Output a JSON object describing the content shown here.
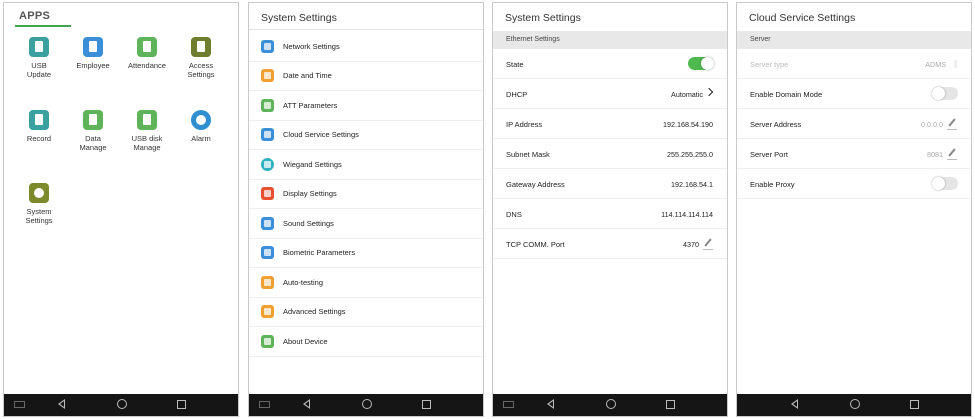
{
  "apps_panel": {
    "tab": "APPS",
    "items": [
      {
        "label": "USB\nUpdate",
        "color": "#3aa0a0"
      },
      {
        "label": "Employee",
        "color": "#3a8fd8"
      },
      {
        "label": "Attendance",
        "color": "#5fb35a"
      },
      {
        "label": "Access\nSettings",
        "color": "#6f7e2e"
      },
      {
        "label": "Record",
        "color": "#3aa0a0"
      },
      {
        "label": "Data\nManage",
        "color": "#5fb35a"
      },
      {
        "label": "USB disk\nManage",
        "color": "#5fb35a"
      },
      {
        "label": "Alarm",
        "color": "#2f8fd0"
      },
      {
        "label": "System\nSettings",
        "color": "#7d8a2c"
      }
    ]
  },
  "system_settings_panel": {
    "title": "System Settings",
    "items": [
      {
        "label": "Network Settings",
        "color": "#3b8fd8"
      },
      {
        "label": "Date and Time",
        "color": "#f0a030"
      },
      {
        "label": "ATT Parameters",
        "color": "#5fb35a"
      },
      {
        "label": "Cloud Service Settings",
        "color": "#3b8fd8"
      },
      {
        "label": "Wiegand Settings",
        "color": "#2fb0c0"
      },
      {
        "label": "Display Settings",
        "color": "#e85030"
      },
      {
        "label": "Sound Settings",
        "color": "#3b8fd8"
      },
      {
        "label": "Biometric Parameters",
        "color": "#3b8fd8"
      },
      {
        "label": "Auto-testing",
        "color": "#f0a030"
      },
      {
        "label": "Advanced Settings",
        "color": "#f0a030"
      },
      {
        "label": "About Device",
        "color": "#5fb35a"
      }
    ]
  },
  "ethernet_panel": {
    "title": "System Settings",
    "section": "Ethernet Settings",
    "rows": {
      "state": {
        "label": "State",
        "on": true
      },
      "dhcp": {
        "label": "DHCP",
        "value": "Automatic"
      },
      "ip": {
        "label": "IP Address",
        "value": "192.168.54.190"
      },
      "mask": {
        "label": "Subnet Mask",
        "value": "255.255.255.0"
      },
      "gateway": {
        "label": "Gateway Address",
        "value": "192.168.54.1"
      },
      "dns": {
        "label": "DNS",
        "value": "114.114.114.114"
      },
      "port": {
        "label": "TCP COMM. Port",
        "value": "4370"
      }
    }
  },
  "cloud_panel": {
    "title": "Cloud Service Settings",
    "section": "Server",
    "rows": {
      "server_type": {
        "label": "Server type",
        "value": "ADMS"
      },
      "domain_mode": {
        "label": "Enable Domain Mode",
        "on": false
      },
      "address": {
        "label": "Server Address",
        "value": "0.0.0.0"
      },
      "port": {
        "label": "Server Port",
        "value": "8081"
      },
      "proxy": {
        "label": "Enable Proxy",
        "on": false
      }
    }
  },
  "colors": {
    "accent": "#3fa34d",
    "toggle_on": "#4fb84f",
    "nav_bar": "#151515"
  }
}
